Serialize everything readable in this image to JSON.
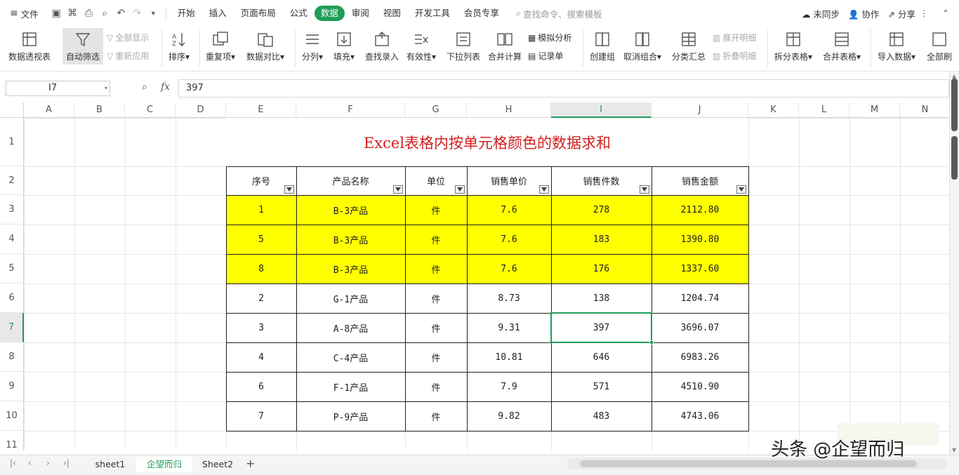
{
  "menubar": {
    "file": "文件",
    "tabs": [
      "开始",
      "插入",
      "页面布局",
      "公式",
      "数据",
      "审阅",
      "视图",
      "开发工具",
      "会员专享"
    ],
    "active_tab": "数据",
    "search_placeholder": "查找命令、搜索模板",
    "sync": "未同步",
    "collab": "协作",
    "share": "分享"
  },
  "ribbon": {
    "pivot": "数据透视表",
    "autofilter": "自动筛选",
    "show_all": "全部显示",
    "reapply": "重新应用",
    "sort": "排序",
    "duplicates": "重复项",
    "compare": "数据对比",
    "split": "分列",
    "fill": "填充",
    "lookup": "查找录入",
    "validity": "有效性",
    "dropdown": "下拉列表",
    "consolidate": "合并计算",
    "simulate": "模拟分析",
    "record": "记录单",
    "group": "创建组",
    "ungroup": "取消组合",
    "subtotal": "分类汇总",
    "expand": "展开明细",
    "collapse": "折叠明细",
    "split_table": "拆分表格",
    "merge_table": "合并表格",
    "import": "导入数据",
    "all": "全部刷"
  },
  "formula_bar": {
    "cell_ref": "I7",
    "fx": "fx",
    "value": "397"
  },
  "sheet": {
    "columns": [
      "A",
      "B",
      "C",
      "D",
      "E",
      "F",
      "G",
      "H",
      "I",
      "J",
      "K",
      "L",
      "M",
      "N"
    ],
    "rows": [
      "1",
      "2",
      "3",
      "4",
      "5",
      "6",
      "7",
      "8",
      "9",
      "10",
      "11"
    ],
    "title": "Excel表格内按单元格颜色的数据求和",
    "headers": [
      "序号",
      "产品名称",
      "单位",
      "销售单价",
      "销售件数",
      "销售金额"
    ],
    "data": [
      [
        "1",
        "B-3产品",
        "件",
        "7.6",
        "278",
        "2112.80"
      ],
      [
        "5",
        "B-3产品",
        "件",
        "7.6",
        "183",
        "1390.80"
      ],
      [
        "8",
        "B-3产品",
        "件",
        "7.6",
        "176",
        "1337.60"
      ],
      [
        "2",
        "G-1产品",
        "件",
        "8.73",
        "138",
        "1204.74"
      ],
      [
        "3",
        "A-8产品",
        "件",
        "9.31",
        "397",
        "3696.07"
      ],
      [
        "4",
        "C-4产品",
        "件",
        "10.81",
        "646",
        "6983.26"
      ],
      [
        "6",
        "F-1产品",
        "件",
        "7.9",
        "571",
        "4510.90"
      ],
      [
        "7",
        "P-9产品",
        "件",
        "9.82",
        "483",
        "4743.06"
      ]
    ],
    "highlight_color": "#ffff00",
    "accent_color": "#1f9d58"
  },
  "sheet_tabs": [
    "sheet1",
    "企望而归",
    "Sheet2"
  ],
  "active_sheet": "企望而归",
  "watermark": "头条 @企望而归"
}
